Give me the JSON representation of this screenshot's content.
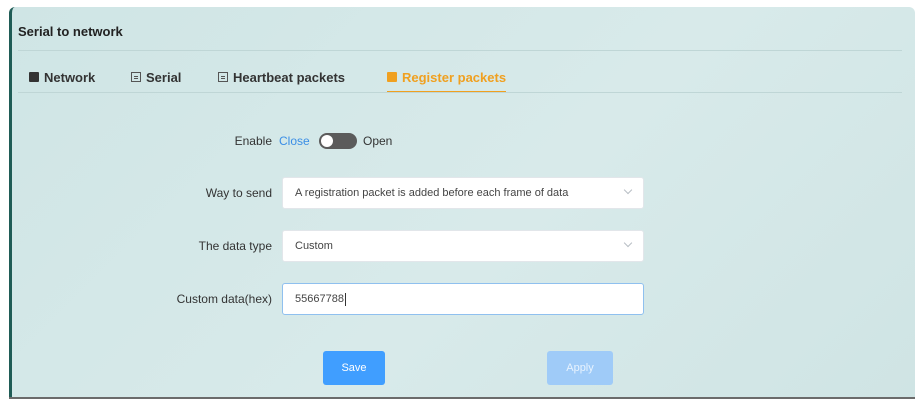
{
  "panel": {
    "title": "Serial to network"
  },
  "tabs": [
    {
      "label": "Network",
      "icon": "box-icon"
    },
    {
      "label": "Serial",
      "icon": "doc-icon"
    },
    {
      "label": "Heartbeat packets",
      "icon": "doc-icon"
    },
    {
      "label": "Register packets",
      "icon": "box-icon",
      "active": true
    }
  ],
  "form": {
    "enable": {
      "label": "Enable",
      "off_text": "Close",
      "on_text": "Open",
      "value": "Close"
    },
    "way_to_send": {
      "label": "Way to send",
      "value": "A registration packet is added before each frame of data"
    },
    "data_type": {
      "label": "The data type",
      "value": "Custom"
    },
    "custom_data": {
      "label": "Custom data(hex)",
      "value": "55667788"
    }
  },
  "buttons": {
    "save": "Save",
    "apply": "Apply"
  },
  "colors": {
    "accent": "#f0a020",
    "primary": "#409eff",
    "primary_disabled": "#9fcbf8",
    "panel_bg": "#d3e8e8"
  }
}
